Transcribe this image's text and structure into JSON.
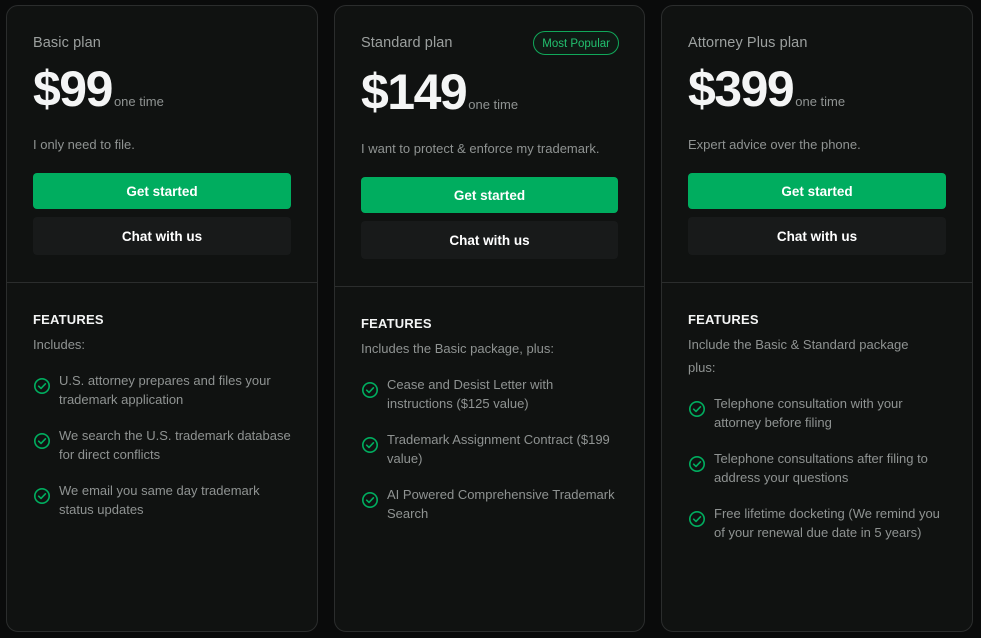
{
  "colors": {
    "accent": "#00ad5f",
    "card_bg": "#101211",
    "border": "#2b2d2d",
    "muted_text": "#8f9392"
  },
  "plans": [
    {
      "name": "Basic plan",
      "badge": "",
      "price": "$99",
      "period": "one time",
      "tagline": "I only need to file.",
      "primary_button": "Get started",
      "secondary_button": "Chat with us",
      "features_title": "FEATURES",
      "includes": "Includes:",
      "features": [
        "U.S. attorney prepares and files your trademark application",
        "We search the U.S. trademark database for direct conflicts",
        "We email you same day trademark status updates"
      ],
      "feature_icon": "check-circle-icon"
    },
    {
      "name": "Standard plan",
      "badge": "Most Popular",
      "price": "$149",
      "period": "one time",
      "tagline": "I want to protect & enforce my trademark.",
      "primary_button": "Get started",
      "secondary_button": "Chat with us",
      "features_title": "FEATURES",
      "includes": "Includes the Basic package, plus:",
      "features": [
        "Cease and Desist Letter with instructions ($125 value)",
        "Trademark Assignment Contract ($199 value)",
        "AI Powered Comprehensive Trademark Search"
      ],
      "feature_icon": "check-circle-icon"
    },
    {
      "name": "Attorney Plus plan",
      "badge": "",
      "price": "$399",
      "period": "one time",
      "tagline": "Expert advice over the phone.",
      "primary_button": "Get started",
      "secondary_button": "Chat with us",
      "features_title": "FEATURES",
      "includes": "Include the Basic & Standard package plus:",
      "features": [
        "Telephone consultation with your attorney before filing",
        "Telephone consultations after filing to address your questions",
        "Free lifetime docketing (We remind you of your renewal due date in 5 years)"
      ],
      "feature_icon": "check-circle-icon"
    }
  ]
}
